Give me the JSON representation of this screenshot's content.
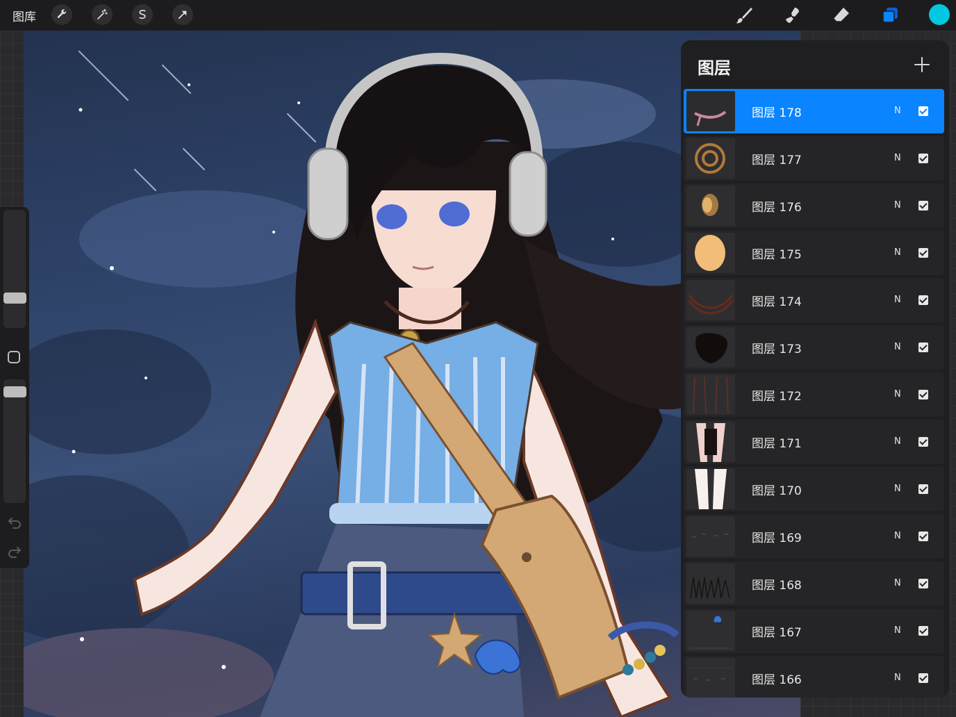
{
  "toolbar": {
    "gallery_label": "图库",
    "left_tools": [
      "wrench-icon",
      "magic-wand-icon",
      "selection-icon",
      "transform-arrow-icon"
    ],
    "right_tools": [
      "brush-icon",
      "smudge-icon",
      "eraser-icon",
      "layers-icon"
    ],
    "current_color": "#00c8e0"
  },
  "sidebar": {
    "brush_size_level": 0.55,
    "opacity_level": 0.95
  },
  "layers_panel": {
    "title": "图层",
    "layers": [
      {
        "name": "图层 178",
        "blend": "N",
        "visible": true,
        "active": true
      },
      {
        "name": "图层 177",
        "blend": "N",
        "visible": true
      },
      {
        "name": "图层 176",
        "blend": "N",
        "visible": true
      },
      {
        "name": "图层 175",
        "blend": "N",
        "visible": true
      },
      {
        "name": "图层 174",
        "blend": "N",
        "visible": true
      },
      {
        "name": "图层 173",
        "blend": "N",
        "visible": true
      },
      {
        "name": "图层 172",
        "blend": "N",
        "visible": true
      },
      {
        "name": "图层 171",
        "blend": "N",
        "visible": true
      },
      {
        "name": "图层 170",
        "blend": "N",
        "visible": true
      },
      {
        "name": "图层 169",
        "blend": "N",
        "visible": true
      },
      {
        "name": "图层 168",
        "blend": "N",
        "visible": true
      },
      {
        "name": "图层 167",
        "blend": "N",
        "visible": true
      },
      {
        "name": "图层 166",
        "blend": "N",
        "visible": true
      }
    ]
  },
  "colors": {
    "accent": "#0a84ff",
    "panel": "#1f1f21"
  }
}
